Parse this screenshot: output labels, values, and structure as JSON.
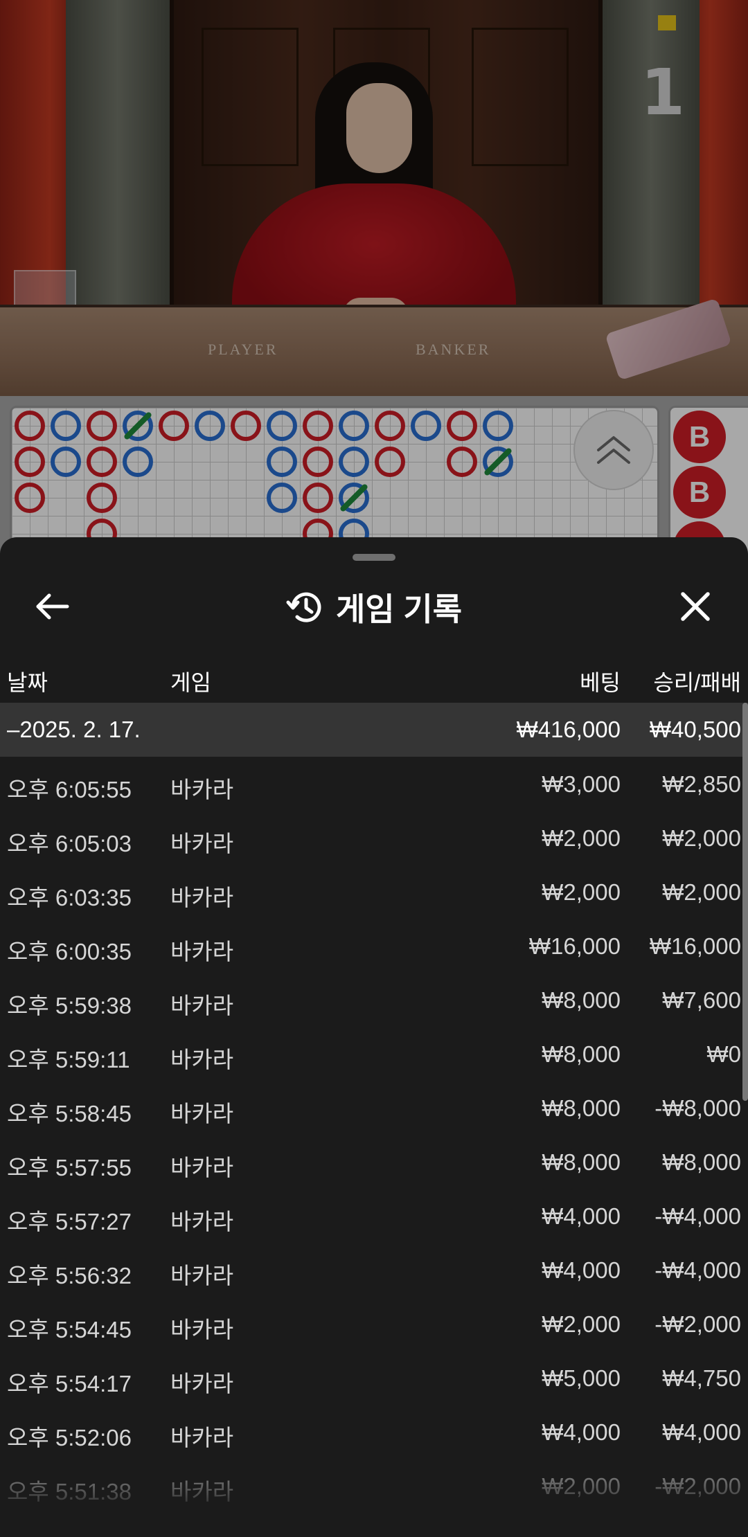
{
  "video": {
    "round_number": "1",
    "table_left_label": "PLAYER",
    "table_right_label": "BANKER"
  },
  "roadmap": {
    "side_bead_label": "B"
  },
  "sheet": {
    "title": "게임 기록",
    "columns": {
      "date": "날짜",
      "game": "게임",
      "bet": "베팅",
      "result": "승리/패배"
    },
    "summary": {
      "date": "–2025. 2. 17.",
      "bet": "₩416,000",
      "result": "₩40,500"
    },
    "rows": [
      {
        "time": "오후 6:05:55",
        "game": "바카라",
        "bet": "₩3,000",
        "result": "₩2,850"
      },
      {
        "time": "오후 6:05:03",
        "game": "바카라",
        "bet": "₩2,000",
        "result": "₩2,000"
      },
      {
        "time": "오후 6:03:35",
        "game": "바카라",
        "bet": "₩2,000",
        "result": "₩2,000"
      },
      {
        "time": "오후 6:00:35",
        "game": "바카라",
        "bet": "₩16,000",
        "result": "₩16,000"
      },
      {
        "time": "오후 5:59:38",
        "game": "바카라",
        "bet": "₩8,000",
        "result": "₩7,600"
      },
      {
        "time": "오후 5:59:11",
        "game": "바카라",
        "bet": "₩8,000",
        "result": "₩0"
      },
      {
        "time": "오후 5:58:45",
        "game": "바카라",
        "bet": "₩8,000",
        "result": "-₩8,000"
      },
      {
        "time": "오후 5:57:55",
        "game": "바카라",
        "bet": "₩8,000",
        "result": "₩8,000"
      },
      {
        "time": "오후 5:57:27",
        "game": "바카라",
        "bet": "₩4,000",
        "result": "-₩4,000"
      },
      {
        "time": "오후 5:56:32",
        "game": "바카라",
        "bet": "₩4,000",
        "result": "-₩4,000"
      },
      {
        "time": "오후 5:54:45",
        "game": "바카라",
        "bet": "₩2,000",
        "result": "-₩2,000"
      },
      {
        "time": "오후 5:54:17",
        "game": "바카라",
        "bet": "₩5,000",
        "result": "₩4,750"
      },
      {
        "time": "오후 5:52:06",
        "game": "바카라",
        "bet": "₩4,000",
        "result": "₩4,000"
      },
      {
        "time": "오후 5:51:38",
        "game": "바카라",
        "bet": "₩2,000",
        "result": "-₩2,000"
      }
    ]
  },
  "colors": {
    "banker": "#d01e26",
    "player": "#2a6fd4",
    "tie": "#1f8a3c",
    "sheet_bg": "#1b1b1b",
    "summary_bg": "#353535"
  }
}
